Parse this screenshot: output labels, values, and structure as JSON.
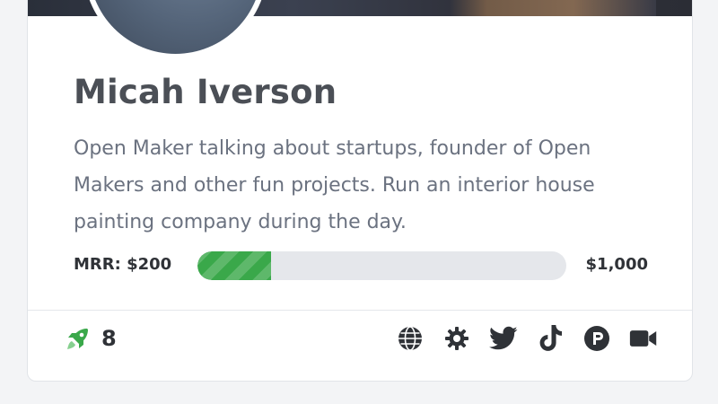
{
  "profile": {
    "name": "Micah Iverson",
    "bio": "Open Maker talking about startups, founder of Open Makers and other fun projects. Run an interior house painting company during the day."
  },
  "mrr": {
    "label": "MRR: $200",
    "goal": "$1,000",
    "current_value": 200,
    "goal_value": 1000,
    "progress_fraction": 0.2
  },
  "footer": {
    "upvotes": "8",
    "upvote_icon": "rocket-icon",
    "links": [
      {
        "icon": "globe-icon"
      },
      {
        "icon": "gear-icon"
      },
      {
        "icon": "twitter-icon"
      },
      {
        "icon": "tiktok-icon"
      },
      {
        "icon": "producthunt-icon"
      },
      {
        "icon": "video-icon"
      }
    ]
  },
  "colors": {
    "progress_fill": "#3aa84a",
    "progress_track": "#e5e7eb",
    "rocket": "#3aa84a",
    "text_dark": "#2f3237",
    "text_muted": "#6b7280"
  }
}
